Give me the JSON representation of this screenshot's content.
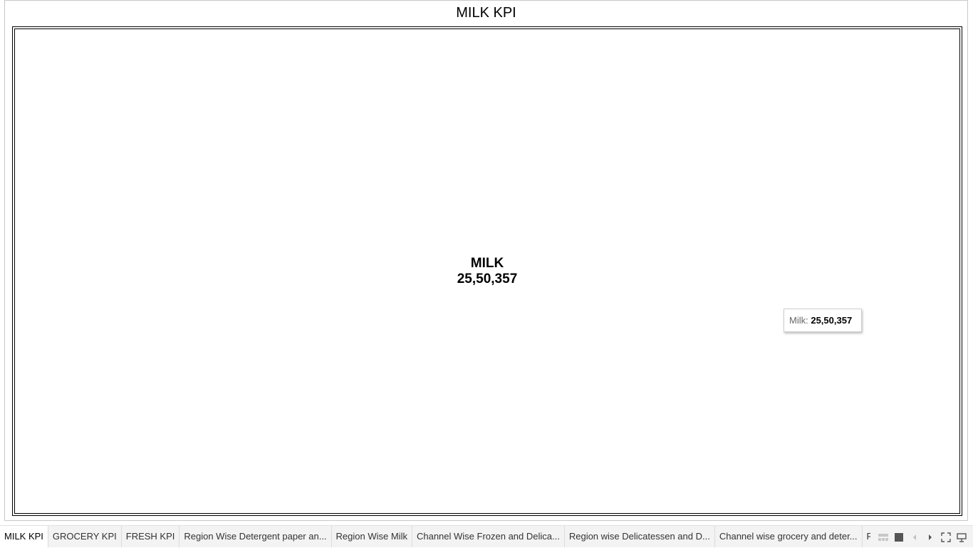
{
  "sheet": {
    "title": "MILK KPI"
  },
  "kpi": {
    "label": "MILK",
    "value": "25,50,357"
  },
  "tooltip": {
    "label": "Milk:",
    "value": "25,50,357"
  },
  "tabs": [
    {
      "label": "MILK KPI",
      "active": true
    },
    {
      "label": "GROCERY KPI",
      "active": false
    },
    {
      "label": "FRESH KPI",
      "active": false
    },
    {
      "label": "Region Wise Detergent paper an...",
      "active": false
    },
    {
      "label": "Region Wise Milk",
      "active": false
    },
    {
      "label": "Channel Wise Frozen and Delica...",
      "active": false
    },
    {
      "label": "Region wise Delicatessen and D...",
      "active": false
    },
    {
      "label": "Channel wise grocery and deter...",
      "active": false
    },
    {
      "label": "Region wise",
      "active": false
    }
  ],
  "controls": [
    {
      "icon": "thumbnail-view-icon"
    },
    {
      "icon": "stop-icon"
    },
    {
      "icon": "previous-sheet-icon"
    },
    {
      "icon": "next-sheet-icon"
    },
    {
      "icon": "fullscreen-icon"
    },
    {
      "icon": "presentation-mode-icon"
    }
  ],
  "colors": {
    "tab_bar_bg": "#f3f3f3",
    "active_tab_bg": "#ffffff",
    "border": "#000000"
  }
}
